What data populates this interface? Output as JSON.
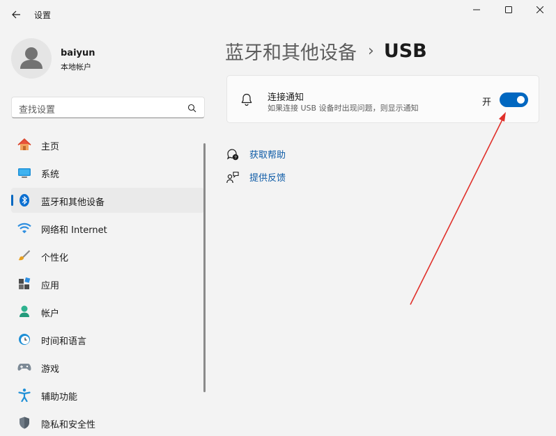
{
  "window": {
    "title": "设置"
  },
  "user": {
    "name": "baiyun",
    "account_type": "本地帐户"
  },
  "search": {
    "placeholder": "查找设置"
  },
  "nav": {
    "items": [
      {
        "label": "主页",
        "icon": "home-icon"
      },
      {
        "label": "系统",
        "icon": "system-icon"
      },
      {
        "label": "蓝牙和其他设备",
        "icon": "bluetooth-icon",
        "selected": true
      },
      {
        "label": "网络和 Internet",
        "icon": "wifi-icon"
      },
      {
        "label": "个性化",
        "icon": "brush-icon"
      },
      {
        "label": "应用",
        "icon": "apps-icon"
      },
      {
        "label": "帐户",
        "icon": "account-icon"
      },
      {
        "label": "时间和语言",
        "icon": "clock-globe-icon"
      },
      {
        "label": "游戏",
        "icon": "gamepad-icon"
      },
      {
        "label": "辅助功能",
        "icon": "accessibility-icon"
      },
      {
        "label": "隐私和安全性",
        "icon": "shield-icon"
      }
    ]
  },
  "breadcrumb": {
    "parent": "蓝牙和其他设备",
    "separator": "›",
    "current": "USB"
  },
  "setting": {
    "title": "连接通知",
    "description": "如果连接 USB 设备时出现问题，则显示通知",
    "state_label": "开",
    "enabled": true
  },
  "links": {
    "help": "获取帮助",
    "feedback": "提供反馈"
  },
  "colors": {
    "accent": "#0067c0",
    "link": "#0c5aa6",
    "annotation_arrow": "#e0302a"
  }
}
